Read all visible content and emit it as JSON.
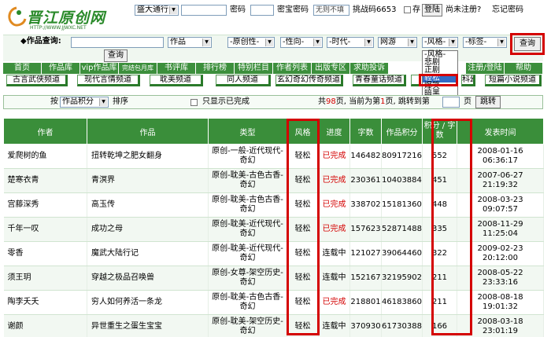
{
  "header": {
    "logo_text": "晋江原创网",
    "logo_url": "HTTP://WWW.JJWXC.NET",
    "login_mode": "盛大通行",
    "password_label": "密码",
    "secure_password_label": "密宝密码",
    "no_fill_label": "无则不填",
    "challenge_label": "挑战码6653",
    "save_label": "存",
    "login_button": "登陆",
    "not_registered": "尚未注册?",
    "forgot_password": "忘记密码"
  },
  "search": {
    "label": "◆作品查询:",
    "type_select": "作品",
    "search_button": "查询",
    "filters": [
      "-原创性-",
      "-性向-",
      "-时代-",
      "网游",
      "-风格-",
      "-标签-"
    ],
    "query_button": "查询"
  },
  "style_dropdown": {
    "options": [
      "-风格-",
      "悲剧",
      "正剧",
      "轻松",
      "爆笑",
      "暗黑"
    ],
    "selected": "轻松"
  },
  "nav": {
    "items": [
      "首页",
      "作品库",
      "vip作品库",
      "完结包月库",
      "书评库",
      "排行榜",
      "特别栏目",
      "作者列表",
      "出版专区",
      "求助投诉",
      "",
      "",
      "注册/登陆",
      "帮助"
    ]
  },
  "channels": [
    "古言武侠频道",
    "现代言情频道",
    "耽美频道",
    "同人频道",
    "玄幻奇幻传奇频道",
    "青春童话频道",
    "",
    "科幻",
    "短篇小说频道"
  ],
  "list_controls": {
    "sort_by_label": "按",
    "sort_select": "作品积分",
    "sort_suffix": "排序",
    "only_completed": "只显示已完成",
    "pages_prefix": "共",
    "total_pages": "98",
    "pages_mid": "页, 当前为第",
    "current_page": "1",
    "pages_after": "页, 跳转到第",
    "page_suffix": "页",
    "jump_button": "跳转"
  },
  "table": {
    "headers": [
      "作者",
      "作品",
      "类型",
      "风格",
      "进度",
      "字数",
      "作品积分",
      "积分 / 字数",
      "发表时间"
    ],
    "rows": [
      {
        "author": "爱爬树的鱼",
        "title": "扭转乾坤之肥女翻身",
        "type": "原创-一般-近代现代-奇幻",
        "style": "轻松",
        "status": "已完成",
        "words": "146482",
        "score": "80917216",
        "ratio": "552",
        "date": "2008-01-16",
        "time": "06:36:17"
      },
      {
        "author": "楚寒衣青",
        "title": "青溟界",
        "type": "原创-耽美-古色古香-奇幻",
        "style": "轻松",
        "status": "已完成",
        "words": "230361",
        "score": "104038848",
        "ratio": "451",
        "date": "2007-06-27",
        "time": "21:19:32"
      },
      {
        "author": "宫藤深秀",
        "title": "高玉传",
        "type": "原创-耽美-古色古香-奇幻",
        "style": "轻松",
        "status": "已完成",
        "words": "338702",
        "score": "151813600",
        "ratio": "448",
        "date": "2008-03-23",
        "time": "09:07:57"
      },
      {
        "author": "千年一叹",
        "title": "成功之母",
        "type": "原创-耽美-近代现代-奇幻",
        "style": "轻松",
        "status": "已完成",
        "words": "157623",
        "score": "52871488",
        "ratio": "335",
        "date": "2008-11-29",
        "time": "11:25:04"
      },
      {
        "author": "零香",
        "title": "魔武大陆行记",
        "type": "原创-耽美-近代现代-奇幻",
        "style": "轻松",
        "status": "连载中",
        "words": "121027",
        "score": "39064460",
        "ratio": "322",
        "date": "2009-02-23",
        "time": "20:12:00"
      },
      {
        "author": "须王玥",
        "title": "穿越之极品召唤兽",
        "type": "原创-女尊-架空历史-奇幻",
        "style": "轻松",
        "status": "连载中",
        "words": "152167",
        "score": "32195902",
        "ratio": "211",
        "date": "2008-05-22",
        "time": "23:33:16"
      },
      {
        "author": "陶李夭夭",
        "title": "穷人如何养活一条龙",
        "type": "原创-耽美-古色古香-奇幻",
        "style": "轻松",
        "status": "已完成",
        "words": "218801",
        "score": "46183860",
        "ratio": "211",
        "date": "2008-08-18",
        "time": "19:01:32"
      },
      {
        "author": "谢颜",
        "title": "异世重生之蛋生宝宝",
        "type": "原创-耽美-架空历史-奇幻",
        "style": "轻松",
        "status": "连载中",
        "words": "370930",
        "score": "61730388",
        "ratio": "166",
        "date": "2008-03-18",
        "time": "23:01:19"
      }
    ]
  },
  "colors": {
    "accent_green": "#3a8e3a",
    "highlight_red": "#d40000",
    "completed_red": "#d40000"
  }
}
